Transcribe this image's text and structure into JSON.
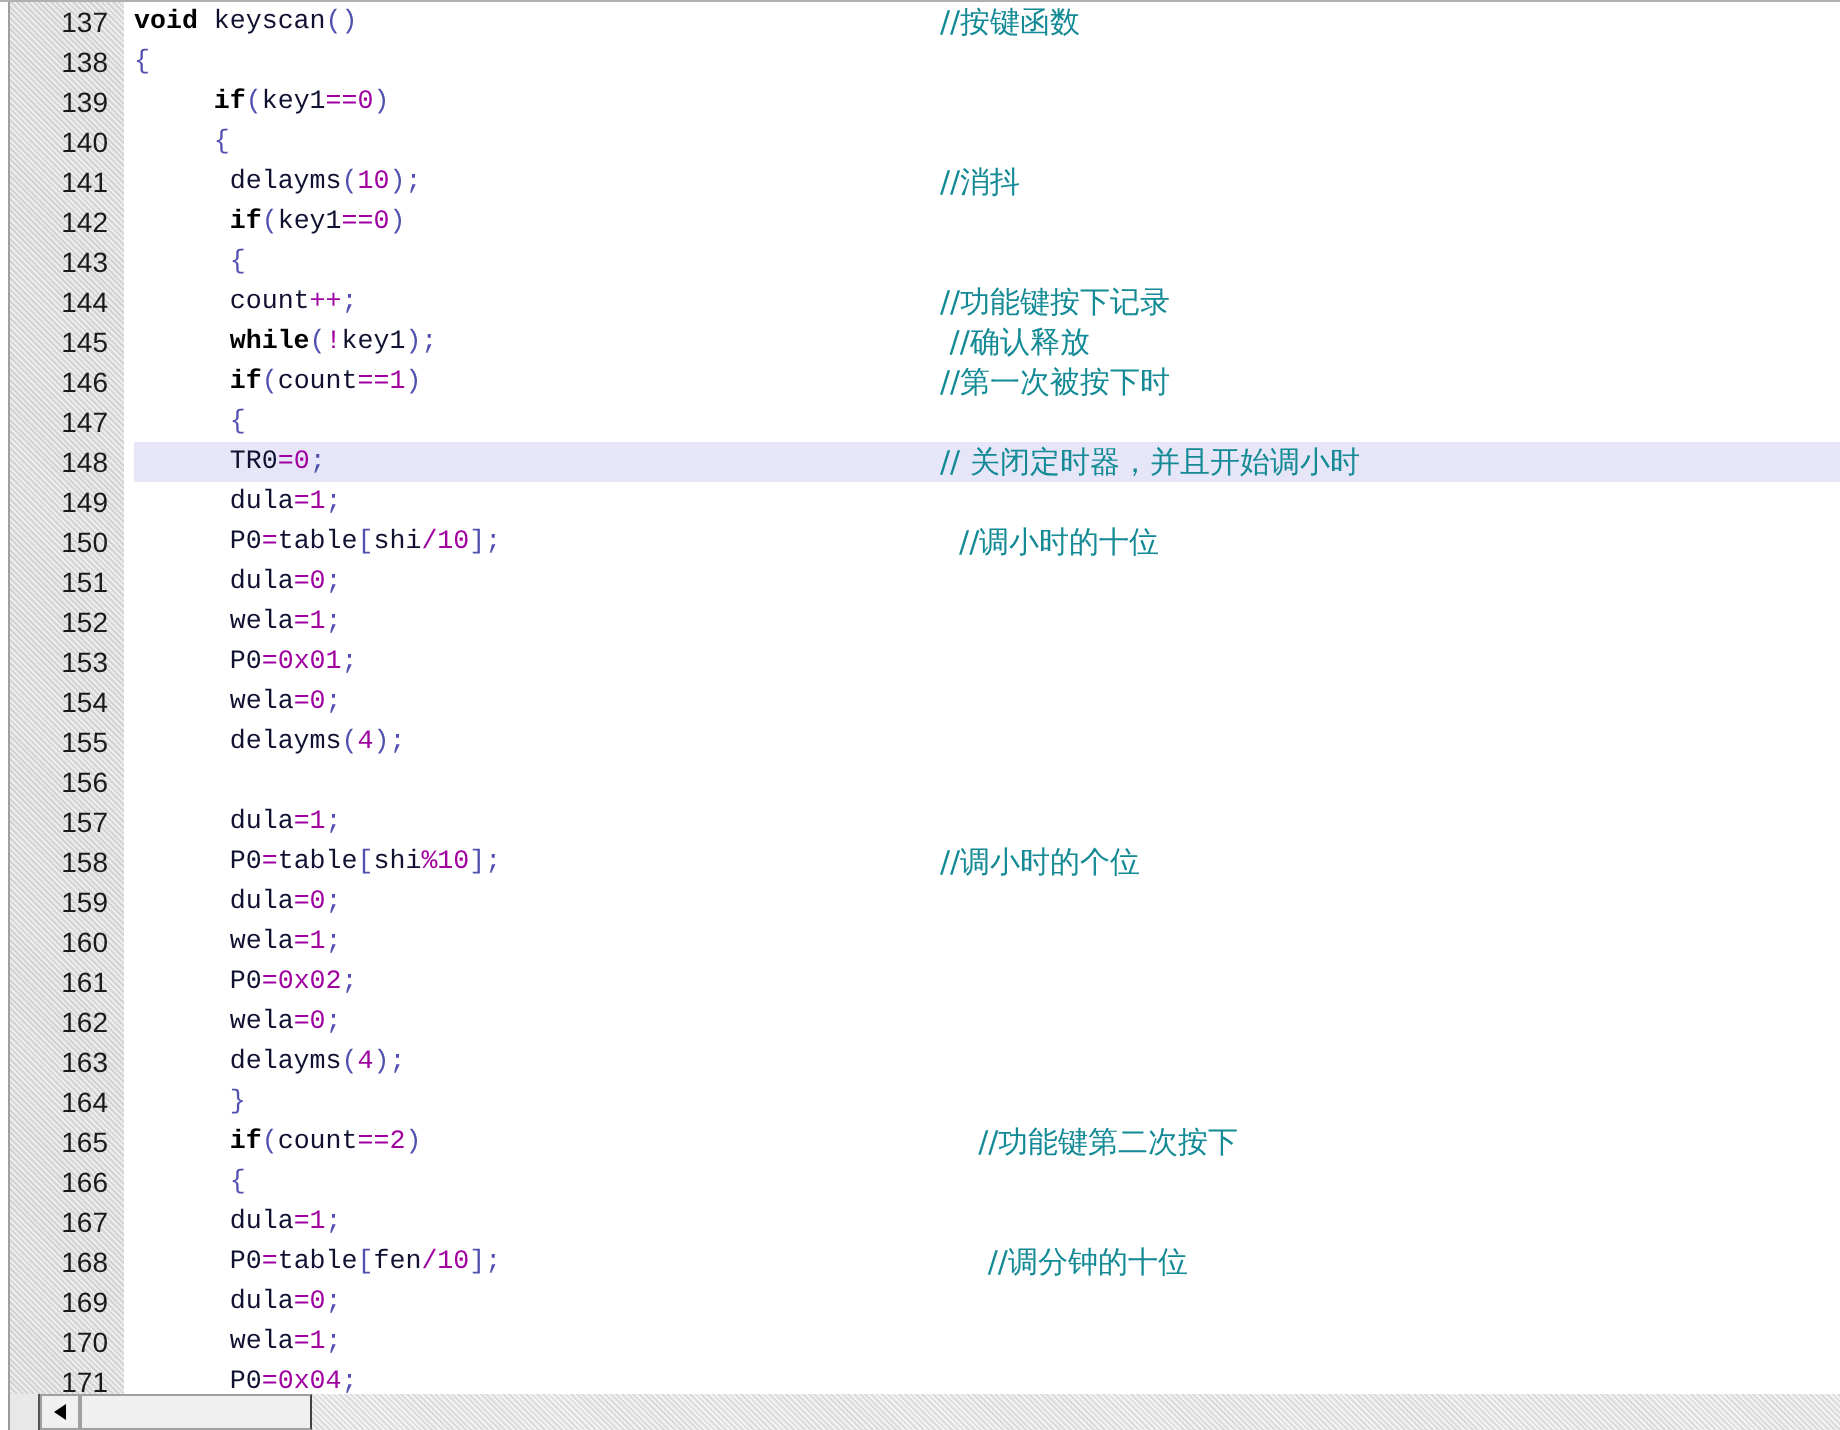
{
  "editor": {
    "lines": [
      {
        "number": "137",
        "code": "void keyscan()",
        "comment": "//按键函数",
        "current": false
      },
      {
        "number": "138",
        "code": "{",
        "current": false
      },
      {
        "number": "139",
        "code": "     if(key1==0)",
        "current": false
      },
      {
        "number": "140",
        "code": "     {",
        "current": false
      },
      {
        "number": "141",
        "code": "      delayms(10);",
        "comment": "//消抖",
        "current": false
      },
      {
        "number": "142",
        "code": "      if(key1==0)",
        "current": false
      },
      {
        "number": "143",
        "code": "      {",
        "current": false
      },
      {
        "number": "144",
        "code": "      count++;",
        "comment": "//功能键按下记录",
        "current": false
      },
      {
        "number": "145",
        "code": "      while(!key1);",
        "comment": " //确认释放",
        "current": false
      },
      {
        "number": "146",
        "code": "      if(count==1)",
        "comment": "//第一次被按下时",
        "current": false
      },
      {
        "number": "147",
        "code": "      {",
        "current": false
      },
      {
        "number": "148",
        "code": "      TR0=0;",
        "comment": "// 关闭定时器，并且开始调小时",
        "current": true
      },
      {
        "number": "149",
        "code": "      dula=1;",
        "current": false
      },
      {
        "number": "150",
        "code": "      P0=table[shi/10];",
        "comment": "  //调小时的十位",
        "current": false
      },
      {
        "number": "151",
        "code": "      dula=0;",
        "current": false
      },
      {
        "number": "152",
        "code": "      wela=1;",
        "current": false
      },
      {
        "number": "153",
        "code": "      P0=0x01;",
        "current": false
      },
      {
        "number": "154",
        "code": "      wela=0;",
        "current": false
      },
      {
        "number": "155",
        "code": "      delayms(4);",
        "current": false
      },
      {
        "number": "156",
        "current": false
      },
      {
        "number": "157",
        "code": "      dula=1;",
        "current": false
      },
      {
        "number": "158",
        "code": "      P0=table[shi%10];",
        "comment": "//调小时的个位",
        "current": false
      },
      {
        "number": "159",
        "code": "      dula=0;",
        "current": false
      },
      {
        "number": "160",
        "code": "      wela=1;",
        "current": false
      },
      {
        "number": "161",
        "code": "      P0=0x02;",
        "current": false
      },
      {
        "number": "162",
        "code": "      wela=0;",
        "current": false
      },
      {
        "number": "163",
        "code": "      delayms(4);",
        "current": false
      },
      {
        "number": "164",
        "code": "      }",
        "current": false
      },
      {
        "number": "165",
        "code": "      if(count==2)",
        "comment": "    //功能键第二次按下",
        "current": false
      },
      {
        "number": "166",
        "code": "      {",
        "current": false
      },
      {
        "number": "167",
        "code": "      dula=1;",
        "current": false
      },
      {
        "number": "168",
        "code": "      P0=table[fen/10];",
        "comment": "     //调分钟的十位",
        "current": false
      },
      {
        "number": "169",
        "code": "      dula=0;",
        "current": false
      },
      {
        "number": "170",
        "code": "      wela=1;",
        "current": false
      },
      {
        "number": "171",
        "code": "      P0=0x04;",
        "current": false
      }
    ]
  }
}
